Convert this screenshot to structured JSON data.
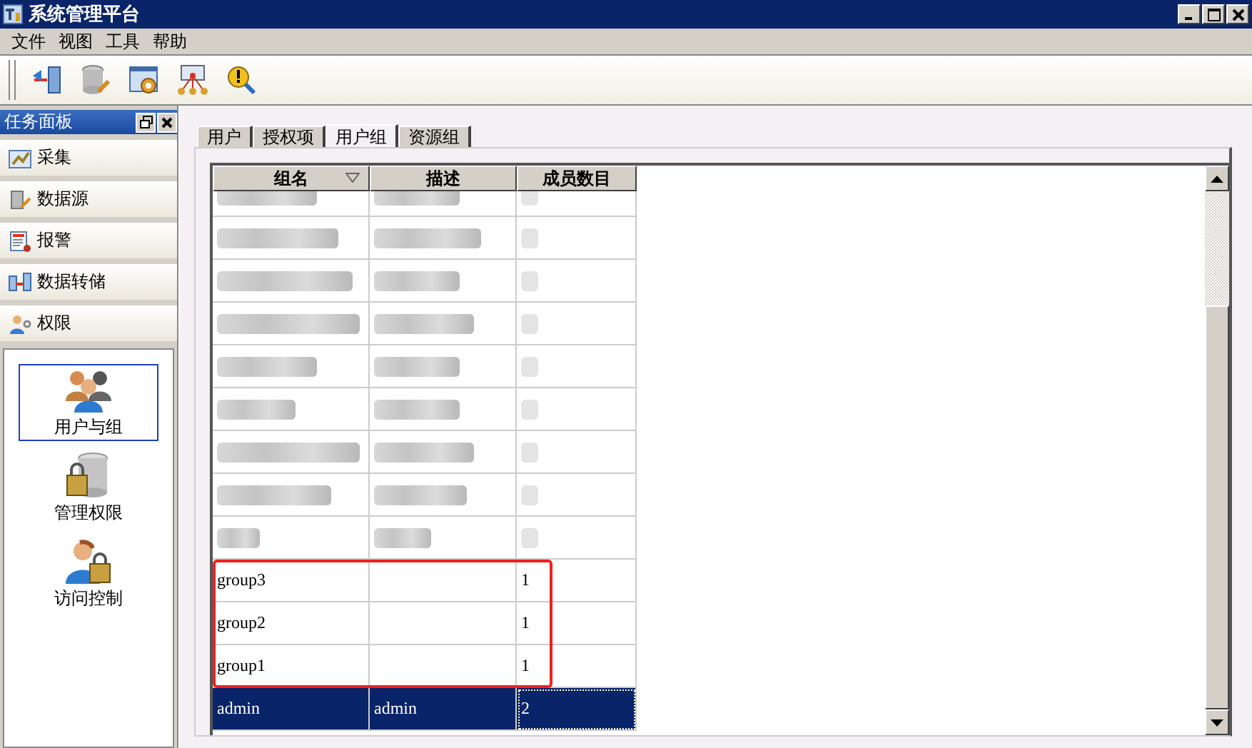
{
  "window": {
    "title": "系统管理平台"
  },
  "menu": [
    "文件",
    "视图",
    "工具",
    "帮助"
  ],
  "task_panel": {
    "title": "任务面板",
    "sections": [
      {
        "label": "采集",
        "kind": "collect"
      },
      {
        "label": "数据源",
        "kind": "datasource"
      },
      {
        "label": "报警",
        "kind": "alarm"
      },
      {
        "label": "数据转储",
        "kind": "dump"
      },
      {
        "label": "权限",
        "kind": "permission"
      }
    ],
    "items": [
      {
        "label": "用户与组",
        "kind": "users",
        "selected": true
      },
      {
        "label": "管理权限",
        "kind": "admin",
        "selected": false
      },
      {
        "label": "访问控制",
        "kind": "access",
        "selected": false
      }
    ]
  },
  "tabs": [
    {
      "label": "用户",
      "selected": false
    },
    {
      "label": "授权项",
      "selected": false
    },
    {
      "label": "用户组",
      "selected": true
    },
    {
      "label": "资源组",
      "selected": false
    }
  ],
  "table": {
    "columns": [
      "组名",
      "描述",
      "成员数目"
    ],
    "rows": [
      {
        "kind": "redacted",
        "selected": false,
        "highlighted": false
      },
      {
        "kind": "redacted",
        "selected": false,
        "highlighted": false
      },
      {
        "kind": "redacted",
        "selected": false,
        "highlighted": false
      },
      {
        "kind": "redacted",
        "selected": false,
        "highlighted": false
      },
      {
        "kind": "redacted",
        "selected": false,
        "highlighted": false
      },
      {
        "kind": "redacted",
        "selected": false,
        "highlighted": false
      },
      {
        "kind": "redacted",
        "selected": false,
        "highlighted": false
      },
      {
        "kind": "redacted",
        "selected": false,
        "highlighted": false
      },
      {
        "kind": "redacted",
        "selected": false,
        "highlighted": false
      },
      {
        "kind": "text",
        "cells": [
          "group3",
          "",
          "1"
        ],
        "selected": false,
        "highlighted": true
      },
      {
        "kind": "text",
        "cells": [
          "group2",
          "",
          "1"
        ],
        "selected": false,
        "highlighted": true
      },
      {
        "kind": "text",
        "cells": [
          "group1",
          "",
          "1"
        ],
        "selected": false,
        "highlighted": true
      },
      {
        "kind": "text",
        "cells": [
          "admin",
          "admin",
          "2"
        ],
        "selected": true,
        "highlighted": false
      }
    ]
  }
}
